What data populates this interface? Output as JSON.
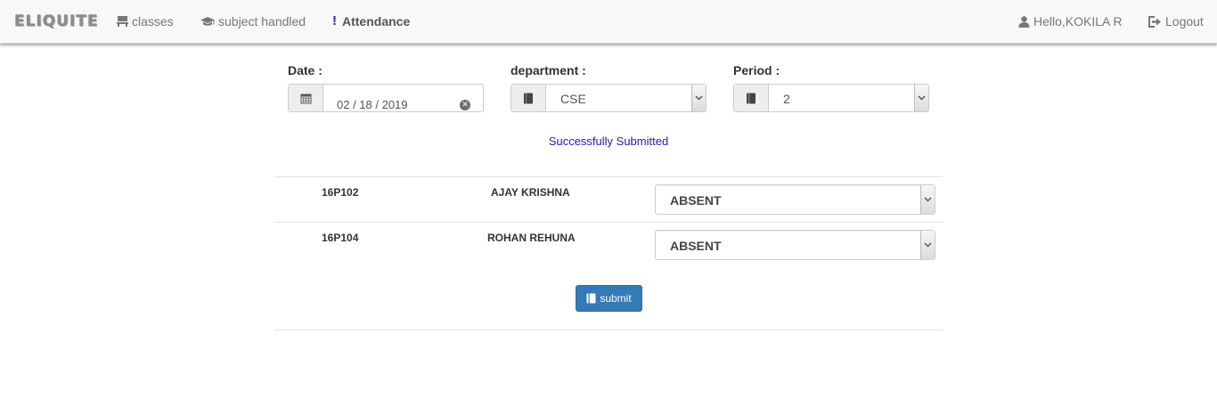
{
  "navbar": {
    "brand": "ELIQUITE",
    "links": [
      {
        "label": "classes",
        "icon": "desk-icon"
      },
      {
        "label": "subject handled",
        "icon": "graduation-cap-icon"
      },
      {
        "label": "Attendance",
        "icon": "exclamation-icon",
        "active": true
      }
    ],
    "user_greeting": "Hello,KOKILA R",
    "logout_label": "Logout"
  },
  "form": {
    "date_label": "Date :",
    "date_value": "02 / 18 / 2019",
    "department_label": "department :",
    "department_value": "CSE",
    "period_label": "Period :",
    "period_value": "2"
  },
  "status_message": "Successfully Submitted",
  "students": [
    {
      "roll": "16P102",
      "name": "AJAY KRISHNA",
      "status": "ABSENT"
    },
    {
      "roll": "16P104",
      "name": "ROHAN REHUNA",
      "status": "ABSENT"
    }
  ],
  "submit_label": "submit",
  "colors": {
    "accent": "#337ab7",
    "status_text": "#1f1fb0",
    "exclamation": "#1f1fd6"
  }
}
